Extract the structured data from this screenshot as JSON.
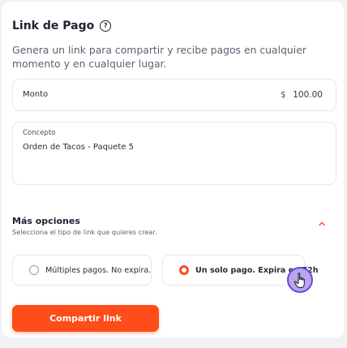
{
  "header": {
    "title": "Link de Pago",
    "help_icon": "question-circle-icon",
    "subtitle": "Genera un link para compartir y recibe pagos en cualquier momento y en cualquier lugar."
  },
  "amount": {
    "label": "Monto",
    "currency": "$",
    "value": "100.00"
  },
  "concept": {
    "label": "Concepto",
    "value": "Orden de Tacos - Paquete 5"
  },
  "more_options": {
    "title": "Más opciones",
    "subtitle": "Selecciona el tipo de link que quieres crear.",
    "toggle_icon": "chevron-up-icon",
    "options": [
      {
        "label": "Múltiples pagos. No expira.",
        "selected": false
      },
      {
        "label": "Un solo pago. Expira en 72h",
        "selected": true
      }
    ]
  },
  "actions": {
    "share_label": "Compartir link"
  },
  "colors": {
    "accent": "#ff4d1a",
    "cursor_highlight": "#6c47d6"
  }
}
